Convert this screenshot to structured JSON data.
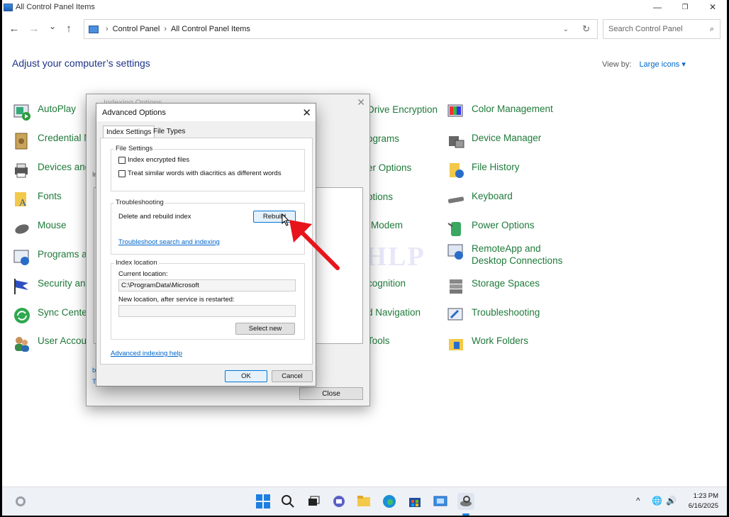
{
  "window": {
    "title": "All Control Panel Items",
    "minimize_icon": "minimize-icon",
    "maximize_icon": "restore-icon",
    "close_icon": "close-icon"
  },
  "nav": {
    "back": "←",
    "forward": "→",
    "recent": "⌄",
    "up": "↑",
    "breadcrumb": [
      "Control Panel",
      "All Control Panel Items"
    ],
    "search_placeholder": "Search Control Panel"
  },
  "header": {
    "title": "Adjust your computer’s settings",
    "view_by_label": "View by:",
    "view_by_value": "Large icons ▾"
  },
  "items_left": [
    "AutoPlay",
    "Credential M",
    "Devices and",
    "Fonts",
    "Mouse",
    "Programs ar",
    "Security and",
    "Sync Center",
    "User Accou"
  ],
  "items_middle": [
    "Drive Encryption",
    "ograms",
    "er Options",
    "ptions",
    "Modem",
    "",
    "cognition",
    "d Navigation",
    "Tools"
  ],
  "items_right": [
    "Color Management",
    "Device Manager",
    "File History",
    "Keyboard",
    "Power Options",
    "RemoteApp and Desktop Connections",
    "Storage Spaces",
    "Troubleshooting",
    "Work Folders"
  ],
  "watermark": "IT Pros HLP",
  "indexing_dialog": {
    "title": "Indexing Options",
    "close_label": "Close",
    "partial_labels": [
      "Ir",
      "b",
      "T"
    ]
  },
  "advanced": {
    "title": "Advanced Options",
    "tabs": [
      "Index Settings",
      "File Types"
    ],
    "file_settings": {
      "legend": "File Settings",
      "option1": "Index encrypted files",
      "option2": "Treat similar words with diacritics as different words"
    },
    "troubleshooting": {
      "legend": "Troubleshooting",
      "delete_label": "Delete and rebuild index",
      "rebuild_button": "Rebuild",
      "link": "Troubleshoot search and indexing"
    },
    "index_location": {
      "legend": "Index location",
      "current_label": "Current location:",
      "current_value": "C:\\ProgramData\\Microsoft",
      "new_label": "New location, after service is restarted:",
      "new_value": "",
      "select_button": "Select new"
    },
    "help_link": "Advanced indexing help",
    "ok": "OK",
    "cancel": "Cancel"
  },
  "taskbar": {
    "time": "1:23 PM",
    "date": "6/16/2025",
    "tray_chevron": "^"
  },
  "colors": {
    "item_green": "#1f7a3a",
    "heading_blue": "#1e3287",
    "link_blue": "#0066cc",
    "arrow_red": "#e8141b"
  }
}
